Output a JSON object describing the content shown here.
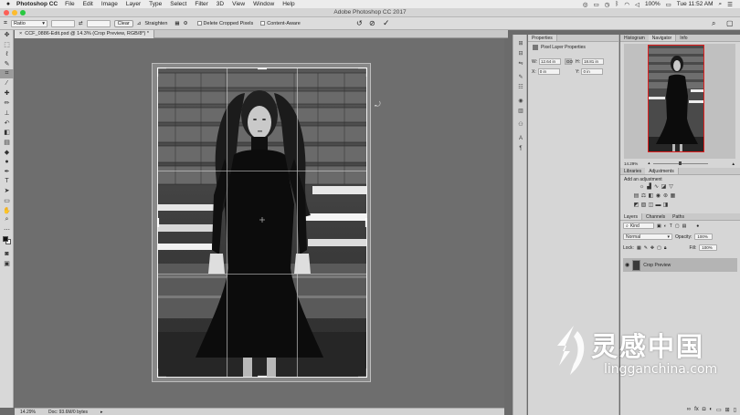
{
  "menubar": {
    "app_name": "Photoshop CC",
    "items": [
      "File",
      "Edit",
      "Image",
      "Layer",
      "Type",
      "Select",
      "Filter",
      "3D",
      "View",
      "Window",
      "Help"
    ],
    "battery": "100%",
    "clock": "Tue 11:52 AM"
  },
  "window": {
    "title": "Adobe Photoshop CC 2017"
  },
  "options": {
    "ratio_label": "Ratio",
    "clear_label": "Clear",
    "straighten_label": "Straighten",
    "delete_cropped_label": "Delete Cropped Pixels",
    "content_aware_label": "Content-Aware"
  },
  "document": {
    "tab_label": "CCF_0886-Edit.psd @ 14.3% (Crop Preview, RGB/8*) *",
    "zoom": "14.29%",
    "doc_size": "Doc: 93.6M/0 bytes"
  },
  "properties": {
    "tab": "Properties",
    "title": "Pixel Layer Properties",
    "w_label": "W:",
    "w_value": "12.64 in",
    "h_label": "H:",
    "h_value": "18.81 in",
    "link_label": "GO",
    "x_label": "X:",
    "x_value": "0 in",
    "y_label": "Y:",
    "y_value": "0 in"
  },
  "navigator": {
    "tabs": [
      "Histogram",
      "Navigator",
      "Info"
    ],
    "zoom": "14.29%"
  },
  "adjustments": {
    "tabs": [
      "Libraries",
      "Adjustments"
    ],
    "add_label": "Add an adjustment"
  },
  "layers": {
    "tabs": [
      "Layers",
      "Channels",
      "Paths"
    ],
    "kind_label": "Kind",
    "blend_mode": "Normal",
    "opacity_label": "Opacity:",
    "opacity_value": "100%",
    "lock_label": "Lock:",
    "fill_label": "Fill:",
    "fill_value": "100%",
    "layer_name": "Crop Preview"
  },
  "watermark": {
    "cn": "灵感中国",
    "url": "lingganchina.com"
  },
  "colors": {
    "accent_red": "#e02020",
    "canvas_gray": "#6e6e6e",
    "panel_gray": "#d6d6d6"
  }
}
